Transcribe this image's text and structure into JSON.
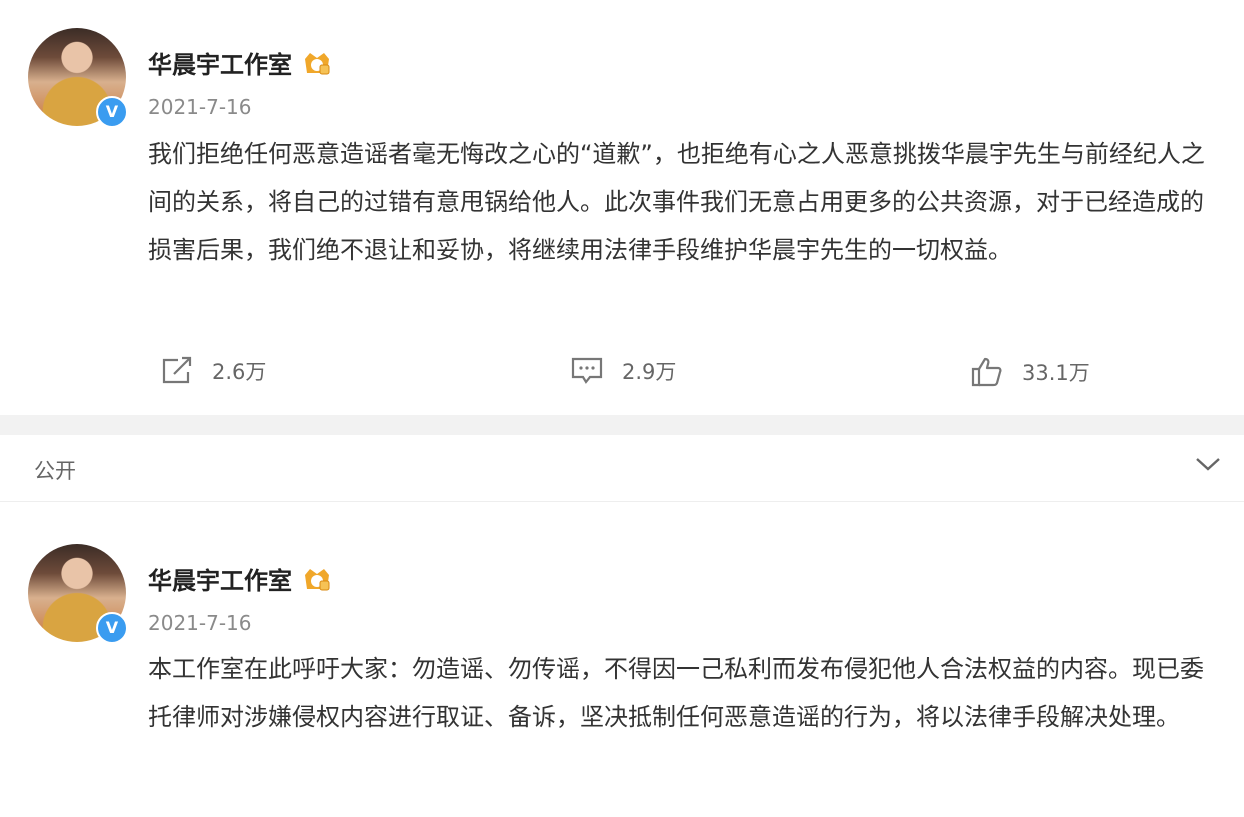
{
  "posts": [
    {
      "author": "华晨宇工作室",
      "date": "2021-7-16",
      "content": "我们拒绝任何恶意造谣者毫无悔改之心的“道歉”，也拒绝有心之人恶意挑拨华晨宇先生与前经纪人之间的关系，将自己的过错有意甩锅给他人。此次事件我们无意占用更多的公共资源，对于已经造成的损害后果，我们绝不退让和妥协，将继续用法律手段维护华晨宇先生的一切权益。",
      "verified_mark": "V",
      "actions": {
        "repost": "2.6万",
        "comment": "2.9万",
        "like": "33.1万"
      }
    },
    {
      "author": "华晨宇工作室",
      "date": "2021-7-16",
      "content": "本工作室在此呼吁大家：勿造谣、勿传谣，不得因一己私利而发布侵犯他人合法权益的内容。现已委托律师对涉嫌侵权内容进行取证、备诉，坚决抵制任何恶意造谣的行为，将以法律手段解决处理。",
      "verified_mark": "V"
    }
  ],
  "visibility": {
    "label": "公开"
  },
  "colors": {
    "verify": "#3a9cf0",
    "crown": "#f0a72a",
    "separator": "#f2f2f2"
  },
  "icons": {
    "repost": "repost-icon",
    "comment": "comment-icon",
    "like": "thumbs-up-icon",
    "expand": "chevron-down-icon",
    "badge": "crown-badge-icon"
  }
}
